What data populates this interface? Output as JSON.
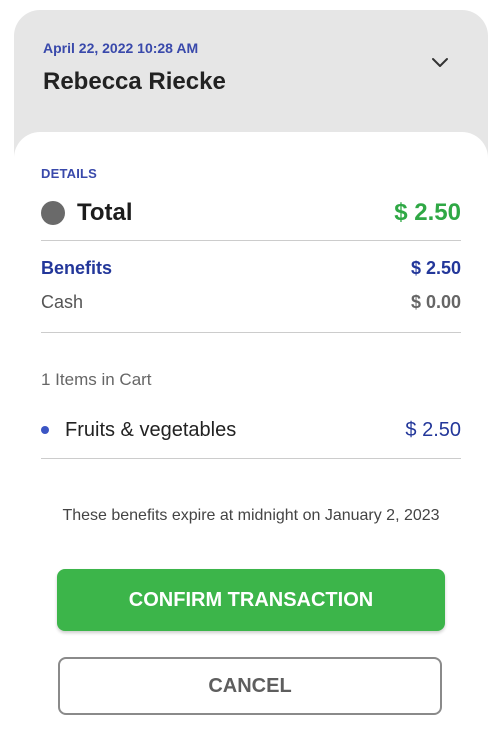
{
  "header": {
    "datetime": "April 22, 2022 10:28 AM",
    "customer_name": "Rebecca Riecke",
    "expand_icon": "chevron-down-icon"
  },
  "details": {
    "section_label": "DETAILS",
    "total_label": "Total",
    "total_amount": "$ 2.50",
    "benefits_label": "Benefits",
    "benefits_amount": "$ 2.50",
    "cash_label": "Cash",
    "cash_amount": "$ 0.00"
  },
  "cart": {
    "items_count_text": "1 Items in Cart",
    "items": [
      {
        "label": "Fruits & vegetables",
        "amount": "$ 2.50"
      }
    ]
  },
  "notice": "These benefits expire at midnight on January 2, 2023",
  "actions": {
    "confirm_label": "CONFIRM TRANSACTION",
    "cancel_label": "CANCEL"
  },
  "colors": {
    "accent_blue": "#3949ab",
    "total_green": "#2fa845",
    "confirm_green": "#3cb54a"
  }
}
